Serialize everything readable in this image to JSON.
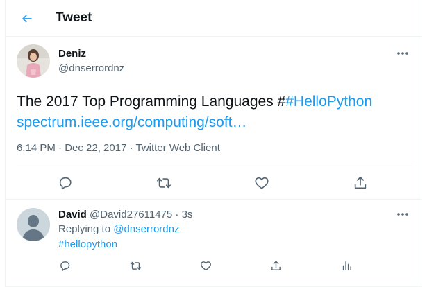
{
  "header": {
    "title": "Tweet",
    "back_icon": "arrow-left-icon",
    "accent_color": "#1d9bf0"
  },
  "tweet": {
    "author_name": "Deniz",
    "author_handle": "@dnserrordnz",
    "text_prefix": "The 2017 Top Programming Languages #",
    "hashtag": "#HelloPython",
    "link": "spectrum.ieee.org/computing/soft…",
    "timestamp": "6:14 PM · Dec 22, 2017 · Twitter Web Client",
    "more_icon": "more-icon",
    "actions": [
      "reply-icon",
      "retweet-icon",
      "like-icon",
      "share-icon"
    ]
  },
  "reply": {
    "author_name": "David",
    "author_handle": "@David27611475",
    "separator": "·",
    "time": "3s",
    "replying_label": "Replying to",
    "replying_handle": "@dnserrordnz",
    "text": "#hellopython",
    "actions": [
      "reply-icon",
      "retweet-icon",
      "like-icon",
      "share-icon",
      "analytics-icon"
    ]
  }
}
